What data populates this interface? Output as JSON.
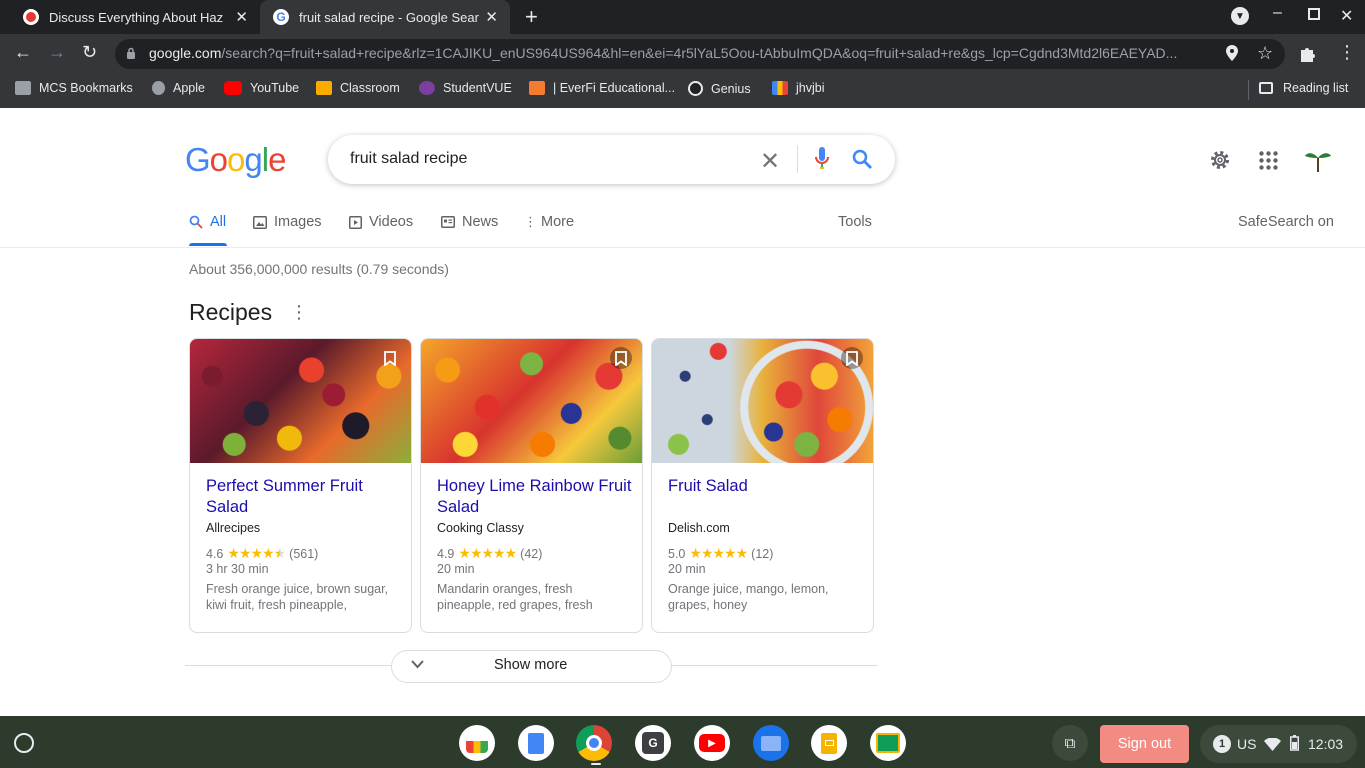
{
  "browser": {
    "tabs": [
      {
        "title": "Discuss Everything About Hazbin",
        "favicon_color": "#e53935"
      },
      {
        "title": "fruit salad recipe - Google Search",
        "favicon_color": "#ffffff"
      }
    ],
    "new_tab_icon": "plus-icon",
    "url_host": "google.com",
    "url_path": "/search?q=fruit+salad+recipe&rlz=1CAJIKU_enUS964US964&hl=en&ei=4r5lYaL5Oou-tAbbuImQDA&oq=fruit+salad+re&gs_lcp=Cgdnd3Mtd2l6EAEYAD...",
    "bookmarks": [
      {
        "label": "MCS Bookmarks",
        "icon": "folder-icon",
        "color": "#9aa0a6"
      },
      {
        "label": "Apple",
        "icon": "apple-icon",
        "color": "#9aa0a6"
      },
      {
        "label": "YouTube",
        "icon": "youtube-icon",
        "color": "#ff0000"
      },
      {
        "label": "Classroom",
        "icon": "classroom-icon",
        "color": "#f9ab00"
      },
      {
        "label": "StudentVUE",
        "icon": "studentvue-icon",
        "color": "#7b3fa0"
      },
      {
        "label": "| EverFi Educational...",
        "icon": "everfi-icon",
        "color": "#f47c30"
      },
      {
        "label": "Genius",
        "icon": "genius-icon",
        "color": "#202124"
      },
      {
        "label": "jhvjbi",
        "icon": "classroom-icon",
        "color": "#4285f4"
      }
    ],
    "reading_list": "Reading list"
  },
  "google": {
    "logo": [
      "G",
      "o",
      "o",
      "g",
      "l",
      "e"
    ],
    "logo_colors": [
      "#4285f4",
      "#ea4335",
      "#fbbc05",
      "#4285f4",
      "#34a853",
      "#ea4335"
    ],
    "query": "fruit salad recipe",
    "tabs": [
      {
        "label": "All",
        "icon": "search-icon"
      },
      {
        "label": "Images",
        "icon": "image-icon"
      },
      {
        "label": "Videos",
        "icon": "video-icon"
      },
      {
        "label": "News",
        "icon": "news-icon"
      },
      {
        "label": "More",
        "icon": "more-vert-icon"
      }
    ],
    "tools": "Tools",
    "safesearch": "SafeSearch on",
    "result_stats": "About 356,000,000 results (0.79 seconds)",
    "recipes_heading": "Recipes",
    "recipes": [
      {
        "title": "Perfect Summer Fruit Salad",
        "source": "Allrecipes",
        "rating": "4.6",
        "stars": 4.6,
        "reviews": "(561)",
        "time": "3 hr 30 min",
        "ingredients": "Fresh orange juice, brown sugar, kiwi fruit, fresh pineapple,"
      },
      {
        "title": "Honey Lime Rainbow Fruit Salad",
        "source": "Cooking Classy",
        "rating": "4.9",
        "stars": 4.9,
        "reviews": "(42)",
        "time": "20 min",
        "ingredients": "Mandarin oranges, fresh pineapple, red grapes, fresh"
      },
      {
        "title": "Fruit Salad",
        "source": "Delish.com",
        "rating": "5.0",
        "stars": 5.0,
        "reviews": "(12)",
        "time": "20 min",
        "ingredients": "Orange juice, mango, lemon, grapes, honey"
      }
    ],
    "show_more": "Show more"
  },
  "shelf": {
    "apps": [
      {
        "icon": "chrome-web-store-icon",
        "glyph": "",
        "bg": "#ffffff"
      },
      {
        "icon": "google-docs-icon",
        "glyph": "",
        "bg": "#4285f4"
      },
      {
        "icon": "chrome-icon",
        "glyph": "",
        "bg": "#db4437"
      },
      {
        "icon": "genius-icon",
        "glyph": "G",
        "bg": "#ffffff"
      },
      {
        "icon": "youtube-icon",
        "glyph": "▶",
        "bg": "#ff0000"
      },
      {
        "icon": "files-icon",
        "glyph": "",
        "bg": "#1a73e8"
      },
      {
        "icon": "google-slides-icon",
        "glyph": "",
        "bg": "#f4b400"
      },
      {
        "icon": "google-classroom-icon",
        "glyph": "",
        "bg": "#0f9d58"
      }
    ],
    "signout": "Sign out",
    "notification_count": "1",
    "keyboard_layout": "US",
    "clock": "12:03"
  }
}
